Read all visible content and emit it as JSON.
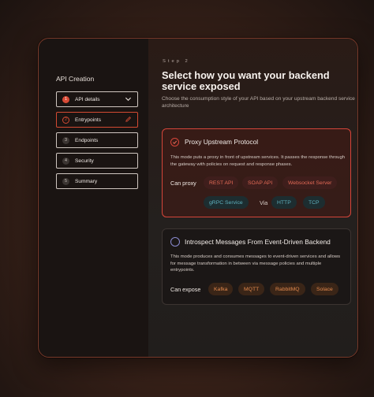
{
  "sidebar": {
    "title": "API Creation",
    "steps": [
      {
        "num": "1",
        "label": "API details"
      },
      {
        "num": "2",
        "label": "Entrypoints"
      },
      {
        "num": "3",
        "label": "Endpoints"
      },
      {
        "num": "4",
        "label": "Security"
      },
      {
        "num": "5",
        "label": "Summary"
      }
    ]
  },
  "main": {
    "step_label": "Step 2",
    "heading": "Select how you want your backend service exposed",
    "subheading": "Choose the consumption style of your API based on your upstream backend service architecture",
    "options": [
      {
        "title": "Proxy Upstream Protocol",
        "description": "This mode puts a proxy in front of upstream services. It passes the response through the gateway with policies on request and response phases.",
        "row_label": "Can proxy",
        "chips": [
          "REST API",
          "SOAP API",
          "Websocket Server",
          "gRPC Service"
        ],
        "via_label": "Via",
        "via_chips": [
          "HTTP",
          "TCP"
        ],
        "selected": true
      },
      {
        "title": "Introspect Messages From Event-Driven Backend",
        "description": "This mode produces and consumes messages to event-driven services and allows for message transformation in between via message policies and multiple entrypoints.",
        "row_label": "Can expose",
        "chips": [
          "Kafka",
          "MQTT",
          "RabbitMQ",
          "Solace"
        ],
        "selected": false
      }
    ]
  },
  "colors": {
    "accent": "#d5453a",
    "chip_red_text": "#e36a56",
    "chip_teal_text": "#5fb2bf",
    "chip_orange_text": "#e38a4e"
  }
}
